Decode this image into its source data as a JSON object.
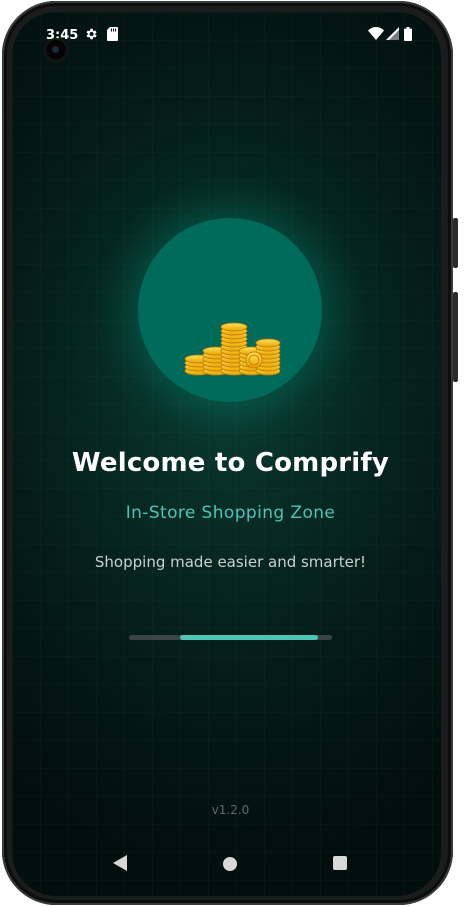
{
  "status_bar": {
    "time": "3:45",
    "icons": [
      "gear-icon",
      "sd-card-icon",
      "wifi-icon",
      "signal-icon",
      "battery-icon"
    ]
  },
  "splash": {
    "logo_icon": "coins-icon",
    "title": "Welcome to Comprify",
    "subtitle": "In-Store Shopping Zone",
    "tagline": "Shopping made easier and smarter!",
    "progress": {
      "start": 0.25,
      "end": 0.93
    },
    "version": "v1.2.0"
  },
  "nav_bar": {
    "icons": [
      "back-icon",
      "home-icon",
      "recents-icon"
    ]
  },
  "colors": {
    "background": "#031613",
    "logo_circle": "#006b5b",
    "accent": "#4fc4b4",
    "title": "#ffffff",
    "tagline": "#c9d1cf",
    "version": "#5d6a67"
  }
}
